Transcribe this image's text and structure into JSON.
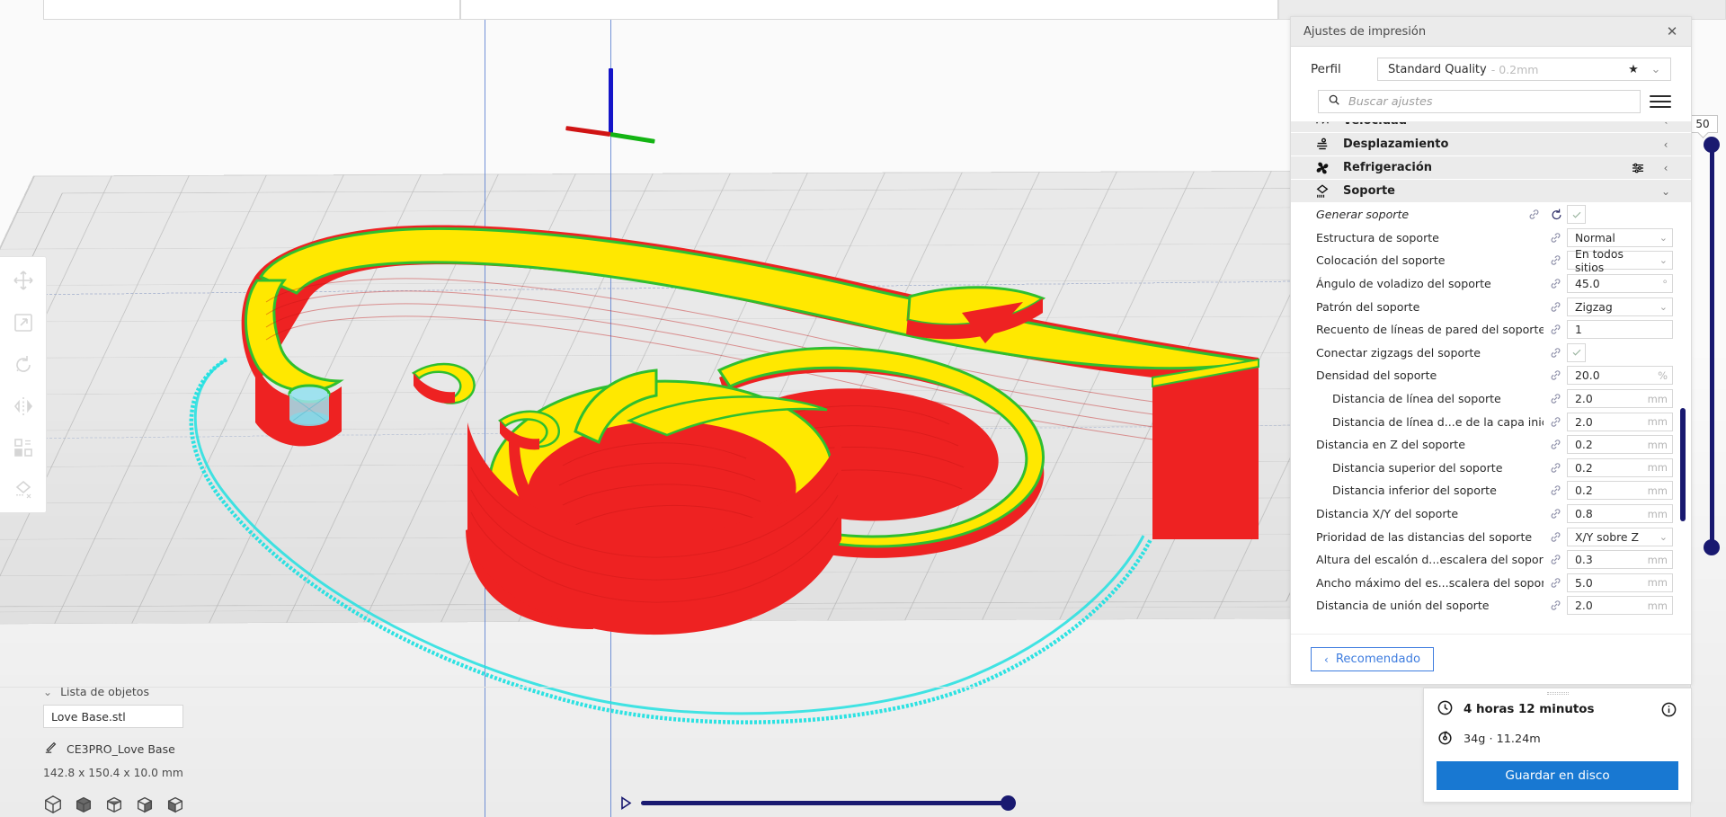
{
  "app": {
    "viewport_name": "3d-print-preview"
  },
  "left_toolbar": {
    "items": [
      {
        "name": "move-tool",
        "icon": "move-icon"
      },
      {
        "name": "scale-tool",
        "icon": "scale-icon"
      },
      {
        "name": "rotate-tool",
        "icon": "rotate-icon"
      },
      {
        "name": "mirror-tool",
        "icon": "mirror-icon"
      },
      {
        "name": "per-model-settings-tool",
        "icon": "per-model-settings-icon"
      },
      {
        "name": "support-blocker-tool",
        "icon": "support-blocker-icon"
      }
    ]
  },
  "object_list": {
    "header": "Lista de objetos",
    "file_name": "Love Base.stl",
    "printer_name": "CE3PRO_Love Base",
    "dimensions": "142.8 x 150.4 x 10.0 mm",
    "view_buttons": [
      "view-iso",
      "view-front",
      "view-top",
      "view-left",
      "view-right"
    ]
  },
  "layer_slider": {
    "value": "50"
  },
  "panel": {
    "title": "Ajustes de impresión",
    "close_label": "✕",
    "profile": {
      "label": "Perfil",
      "name": "Standard Quality",
      "sub": "- 0.2mm",
      "star": "★",
      "chevron": "⌄"
    },
    "search": {
      "placeholder": "Buscar ajustes",
      "value": ""
    },
    "categories_and_settings": [
      {
        "kind": "category",
        "name": "velocidad",
        "label": "Velocidad",
        "icon": "speed-icon",
        "gear": false,
        "chevron": "‹",
        "clipped": true
      },
      {
        "kind": "category",
        "name": "desplazamiento",
        "label": "Desplazamiento",
        "icon": "travel-icon",
        "gear": false,
        "chevron": "‹"
      },
      {
        "kind": "category",
        "name": "refrigeracion",
        "label": "Refrigeración",
        "icon": "cooling-icon",
        "gear": true,
        "chevron": "‹"
      },
      {
        "kind": "category",
        "name": "soporte",
        "label": "Soporte",
        "icon": "support-icon",
        "gear": false,
        "chevron": "⌄"
      },
      {
        "kind": "setting",
        "name": "generar-soporte",
        "label": "Generar soporte",
        "italic": true,
        "indent": 0,
        "link": true,
        "reset": true,
        "control": "checkbox",
        "checked": true
      },
      {
        "kind": "setting",
        "name": "estructura-de-soporte",
        "label": "Estructura de soporte",
        "indent": 0,
        "link": true,
        "control": "dropdown",
        "value": "Normal"
      },
      {
        "kind": "setting",
        "name": "colocacion-del-soporte",
        "label": "Colocación del soporte",
        "indent": 0,
        "link": true,
        "control": "dropdown",
        "value": "En todos sitios"
      },
      {
        "kind": "setting",
        "name": "angulo-de-voladizo-del-soporte",
        "label": "Ángulo de voladizo del soporte",
        "indent": 0,
        "link": true,
        "control": "text",
        "value": "45.0",
        "unit": "°"
      },
      {
        "kind": "setting",
        "name": "patron-del-soporte",
        "label": "Patrón del soporte",
        "indent": 0,
        "link": true,
        "control": "dropdown",
        "value": "Zigzag"
      },
      {
        "kind": "setting",
        "name": "recuento-de-lineas-de-pared-del-soporte",
        "label": "Recuento de líneas de pared del soporte",
        "indent": 0,
        "link": true,
        "control": "text",
        "value": "1",
        "unit": ""
      },
      {
        "kind": "setting",
        "name": "conectar-zigzags-del-soporte",
        "label": "Conectar zigzags del soporte",
        "indent": 0,
        "link": true,
        "control": "checkbox",
        "checked": true
      },
      {
        "kind": "setting",
        "name": "densidad-del-soporte",
        "label": "Densidad del soporte",
        "indent": 0,
        "link": true,
        "control": "text",
        "value": "20.0",
        "unit": "%"
      },
      {
        "kind": "setting",
        "name": "distancia-de-linea-del-soporte",
        "label": "Distancia de línea del soporte",
        "indent": 1,
        "link": true,
        "control": "text",
        "value": "2.0",
        "unit": "mm"
      },
      {
        "kind": "setting",
        "name": "distancia-de-linea-de-la-capa-inicial",
        "label": "Distancia de línea d...e de la capa inicial",
        "indent": 1,
        "link": true,
        "control": "text",
        "value": "2.0",
        "unit": "mm"
      },
      {
        "kind": "setting",
        "name": "distancia-en-z-del-soporte",
        "label": "Distancia en Z del soporte",
        "indent": 0,
        "link": true,
        "control": "text",
        "value": "0.2",
        "unit": "mm"
      },
      {
        "kind": "setting",
        "name": "distancia-superior-del-soporte",
        "label": "Distancia superior del soporte",
        "indent": 1,
        "link": true,
        "control": "text",
        "value": "0.2",
        "unit": "mm"
      },
      {
        "kind": "setting",
        "name": "distancia-inferior-del-soporte",
        "label": "Distancia inferior del soporte",
        "indent": 1,
        "link": true,
        "control": "text",
        "value": "0.2",
        "unit": "mm"
      },
      {
        "kind": "setting",
        "name": "distancia-xy-del-soporte",
        "label": "Distancia X/Y del soporte",
        "indent": 0,
        "link": true,
        "control": "text",
        "value": "0.8",
        "unit": "mm"
      },
      {
        "kind": "setting",
        "name": "prioridad-de-las-distancias-del-soporte",
        "label": "Prioridad de las distancias del soporte",
        "indent": 0,
        "link": true,
        "control": "dropdown",
        "value": "X/Y sobre Z"
      },
      {
        "kind": "setting",
        "name": "altura-del-escalon-escalera-del-soporte",
        "label": "Altura del escalón d...escalera del soporte",
        "indent": 0,
        "link": true,
        "control": "text",
        "value": "0.3",
        "unit": "mm"
      },
      {
        "kind": "setting",
        "name": "ancho-maximo-del-escalon-escalera-del-soporte",
        "label": "Ancho máximo del es...scalera del soporte",
        "indent": 0,
        "link": true,
        "control": "text",
        "value": "5.0",
        "unit": "mm"
      },
      {
        "kind": "setting",
        "name": "distancia-de-union-del-soporte",
        "label": "Distancia de unión del soporte",
        "indent": 0,
        "link": true,
        "control": "text",
        "value": "2.0",
        "unit": "mm"
      }
    ],
    "footer": {
      "recommended_label": "Recomendado",
      "recommended_chevron": "‹"
    }
  },
  "print_info": {
    "time": "4 horas 12 minutos",
    "material": "34g · 11.24m",
    "save_label": "Guardar en disco",
    "info_label": "i"
  },
  "colors": {
    "model_top": "#FFE800",
    "model_side": "#EE2222",
    "model_edge": "#2FBF2F",
    "support": "#8FDCE8",
    "travel": "#21E0E0",
    "accent_blue": "#1878d2",
    "slider_navy": "#191970",
    "plate": "#e9e9e9"
  }
}
